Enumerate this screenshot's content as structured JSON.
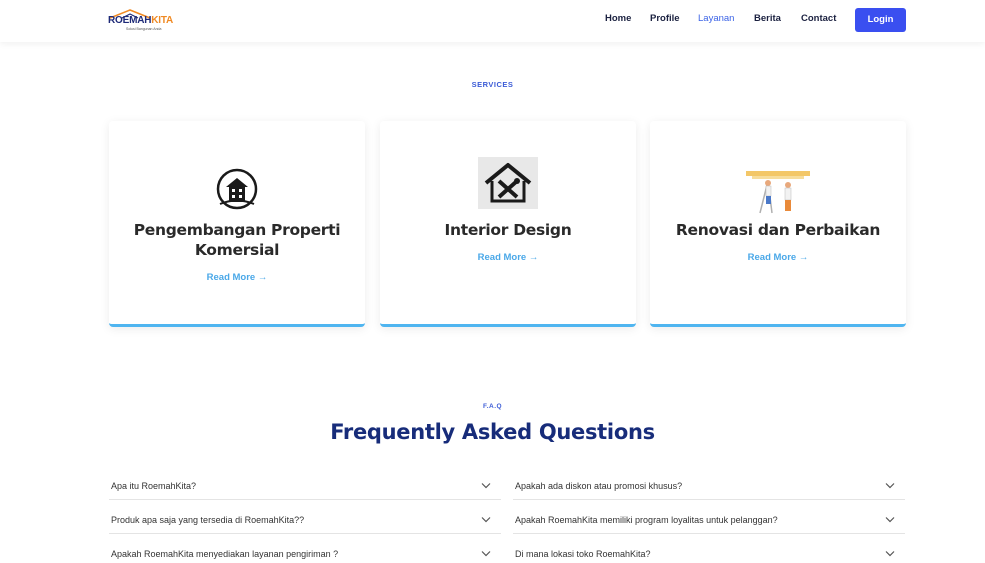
{
  "header": {
    "logo": {
      "name_part1": "ROEMAH",
      "name_part2": "KITA",
      "tagline": "Solusi Bangunan Anda"
    },
    "nav": [
      "Home",
      "Profile",
      "Layanan",
      "Berita",
      "Contact"
    ],
    "active_nav": "Layanan",
    "login_label": "Login"
  },
  "services": {
    "label": "SERVICES",
    "cards": [
      {
        "title_line1": "Pengembangan Properti",
        "title_line2": "Komersial",
        "link": "Read More →",
        "icon": "building-icon"
      },
      {
        "title_line1": "Interior Design",
        "title_line2": "",
        "link": "Read More →",
        "icon": "house-tools-icon"
      },
      {
        "title_line1": "Renovasi dan Perbaikan",
        "title_line2": "",
        "link": "Read More →",
        "icon": "renovation-workers-icon"
      }
    ]
  },
  "faq": {
    "label": "F.A.Q",
    "title": "Frequently Asked Questions",
    "left": [
      "Apa itu RoemahKita?",
      "Produk apa saja yang tersedia di RoemahKita??",
      "Apakah RoemahKita menyediakan layanan pengiriman ?"
    ],
    "right": [
      "Apakah ada diskon atau promosi khusus?",
      "Apakah RoemahKita memiliki program loyalitas untuk pelanggan?",
      "Di mana lokasi toko RoemahKita?"
    ]
  },
  "colors": {
    "brand_navy": "#172c7a",
    "accent_blue": "#3a4ff0",
    "link_blue": "#4aa8e8",
    "logo_orange": "#f08a24"
  }
}
